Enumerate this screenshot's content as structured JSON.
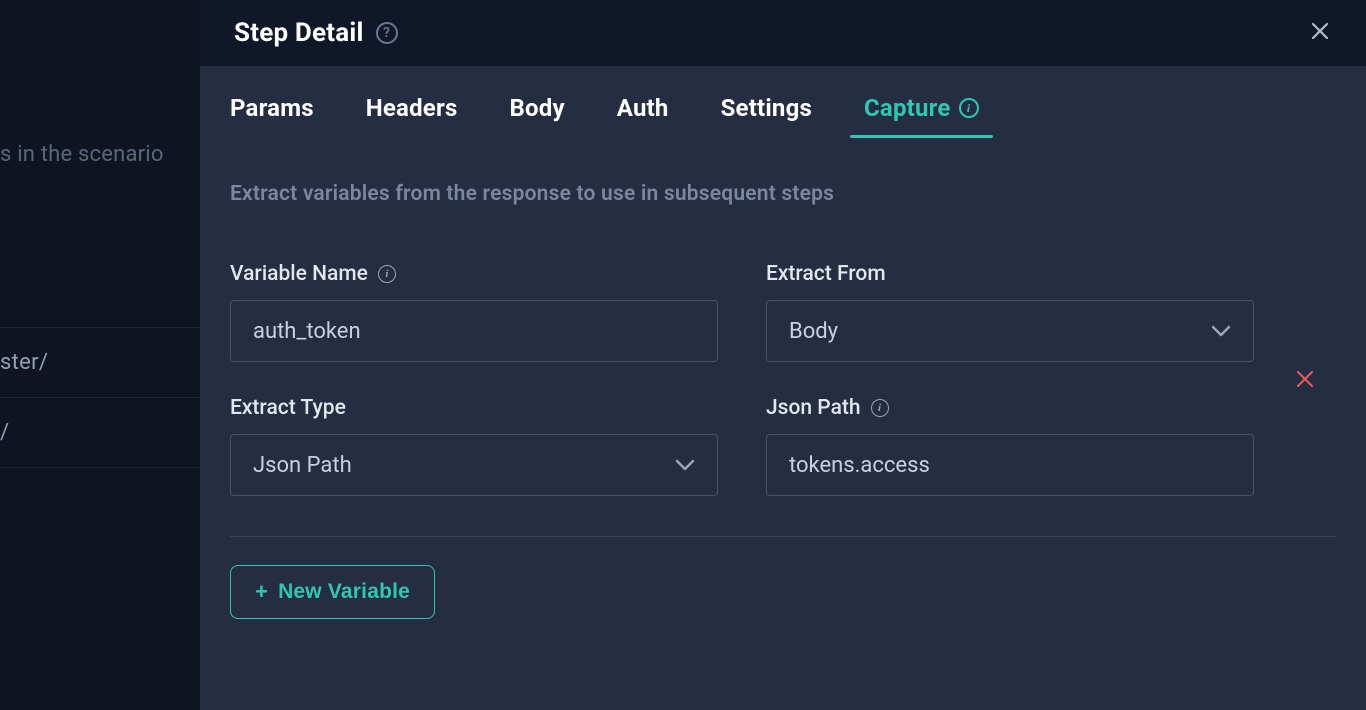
{
  "background": {
    "hint": "s in the scenario",
    "items": [
      "ster/",
      "/",
      ""
    ]
  },
  "header": {
    "title": "Step Detail"
  },
  "tabs": [
    {
      "label": "Params",
      "active": false
    },
    {
      "label": "Headers",
      "active": false
    },
    {
      "label": "Body",
      "active": false
    },
    {
      "label": "Auth",
      "active": false
    },
    {
      "label": "Settings",
      "active": false
    },
    {
      "label": "Capture",
      "active": true,
      "info": true
    }
  ],
  "capture": {
    "intro": "Extract variables from the response to use in subsequent steps",
    "labels": {
      "variable_name": "Variable Name",
      "extract_from": "Extract From",
      "extract_type": "Extract Type",
      "json_path": "Json Path"
    },
    "variables": [
      {
        "name": "auth_token",
        "extract_from": "Body",
        "extract_type": "Json Path",
        "json_path": "tokens.access"
      }
    ],
    "new_variable_label": "New Variable"
  }
}
